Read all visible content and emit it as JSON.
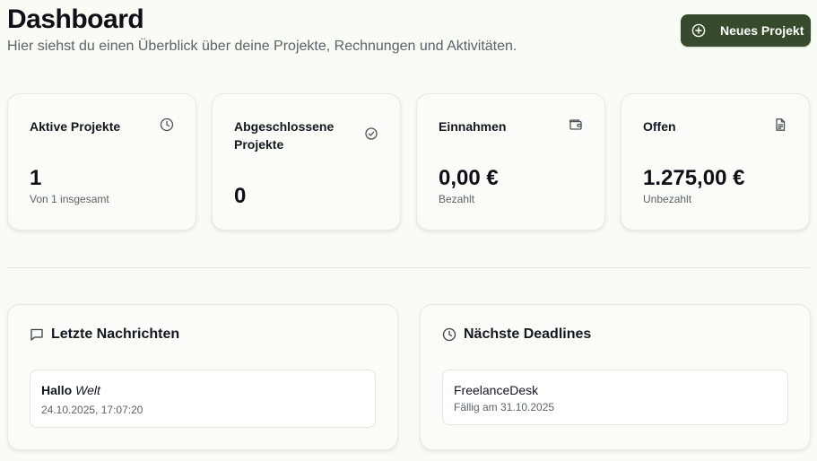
{
  "header": {
    "title": "Dashboard",
    "subtitle": "Hier siehst du einen Überblick über deine Projekte, Rechnungen und Aktivitäten.",
    "new_project_label": "Neues Projekt",
    "new_project_icon": "plus-circle-icon"
  },
  "stats": [
    {
      "title": "Aktive Projekte",
      "value": "1",
      "sub": "Von 1 insgesamt",
      "icon": "clock-icon"
    },
    {
      "title": "Abgeschlossene Projekte",
      "value": "0",
      "sub": "",
      "icon": "check-circle-icon"
    },
    {
      "title": "Einnahmen",
      "value": "0,00 €",
      "sub": "Bezahlt",
      "icon": "wallet-icon"
    },
    {
      "title": "Offen",
      "value": "1.275,00 €",
      "sub": "Unbezahlt",
      "icon": "document-icon"
    }
  ],
  "messages": {
    "title": "Letzte Nachrichten",
    "icon": "message-square-icon",
    "items": [
      {
        "bold": "Hallo",
        "italic": "Welt",
        "timestamp": "24.10.2025, 17:07:20"
      }
    ]
  },
  "deadlines": {
    "title": "Nächste Deadlines",
    "icon": "clock-icon",
    "items": [
      {
        "name": "FreelanceDesk",
        "due": "Fällig am 31.10.2025"
      }
    ]
  },
  "colors": {
    "background": "#f9fbf5",
    "accent": "#374a2c",
    "muted_text": "#5b6469"
  }
}
